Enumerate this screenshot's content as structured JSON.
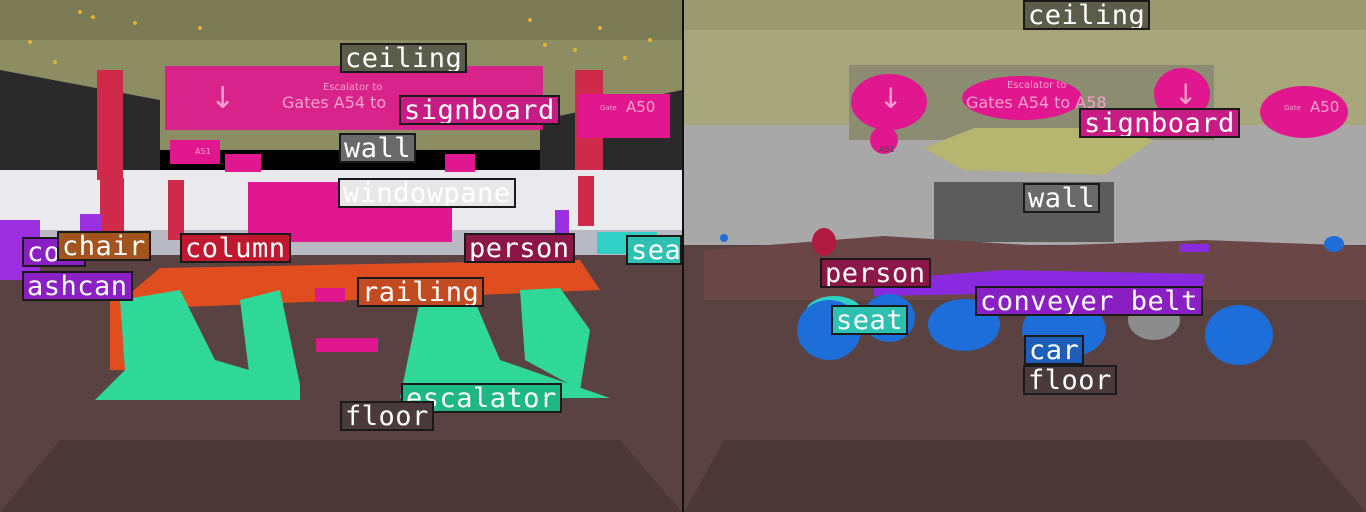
{
  "left": {
    "sign_text": "Escalator to",
    "sign_text2": "Gates A54 to",
    "gate_text": "A50",
    "gate_small": "Gate",
    "sign_a51": "A51",
    "labels": [
      {
        "text": "ceiling",
        "color": "#5c5c4a"
      },
      {
        "text": "signboard",
        "color": "#c71c84"
      },
      {
        "text": "wall",
        "color": "#6a6a6a"
      },
      {
        "text": "windowpane",
        "color": "#e8e8e8"
      },
      {
        "text": "co",
        "color": "#8a1fc4"
      },
      {
        "text": "chair",
        "color": "#a3541e"
      },
      {
        "text": "column",
        "color": "#c0182e"
      },
      {
        "text": "person",
        "color": "#8b1747"
      },
      {
        "text": "sea",
        "color": "#2ec0b0"
      },
      {
        "text": "ashcan",
        "color": "#8a1fc4"
      },
      {
        "text": "railing",
        "color": "#c24b22"
      },
      {
        "text": "escalator",
        "color": "#1fb784"
      },
      {
        "text": "floor",
        "color": "#4a3a3c"
      }
    ]
  },
  "right": {
    "sign_text": "Escalator to",
    "sign_text2": "Gates A54 to A58",
    "gate_text": "A50",
    "gate_small": "Gate",
    "sign_a51": "A51",
    "labels": [
      {
        "text": "ceiling",
        "color": "#5c5c4a"
      },
      {
        "text": "signboard",
        "color": "#c71c84"
      },
      {
        "text": "wall",
        "color": "#6a6a6a"
      },
      {
        "text": "person",
        "color": "#8b1747"
      },
      {
        "text": "conveyer belt",
        "color": "#8a1fc4"
      },
      {
        "text": "seat",
        "color": "#2ec0b0"
      },
      {
        "text": "car",
        "color": "#1d5fb8"
      },
      {
        "text": "floor",
        "color": "#4a3a3c"
      }
    ]
  }
}
